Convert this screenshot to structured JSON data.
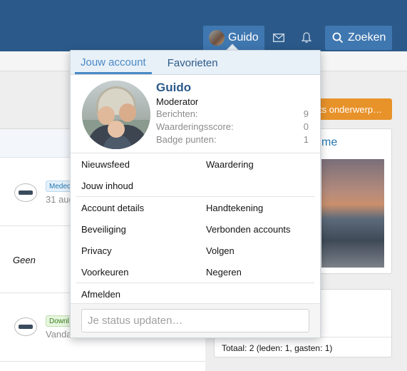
{
  "nav": {
    "username": "Guido",
    "search_label": "Zoeken"
  },
  "page": {
    "badge1": "Medec",
    "row1_date": "31 aug",
    "row2_text": "Geen",
    "badge2": "Downl",
    "row3_text": "Vanda",
    "orange_button": "ts onderwerp…",
    "card_title": "me",
    "totaal": "Totaal: 2 (leden: 1, gasten: 1)"
  },
  "menu": {
    "tabs": [
      "Jouw account",
      "Favorieten"
    ],
    "profile": {
      "name": "Guido",
      "role": "Moderator",
      "stats": [
        {
          "label": "Berichten:",
          "value": "9"
        },
        {
          "label": "Waarderingsscore:",
          "value": "0"
        },
        {
          "label": "Badge punten:",
          "value": "1"
        }
      ]
    },
    "links": {
      "nieuwsfeed": "Nieuwsfeed",
      "waardering": "Waardering",
      "jouw_inhoud": "Jouw inhoud",
      "account_details": "Account details",
      "handtekening": "Handtekening",
      "beveiliging": "Beveiliging",
      "verbonden_accounts": "Verbonden accounts",
      "privacy": "Privacy",
      "volgen": "Volgen",
      "voorkeuren": "Voorkeuren",
      "negeren": "Negeren",
      "afmelden": "Afmelden"
    },
    "status_placeholder": "Je status updaten…"
  },
  "colors": {
    "header": "#2b5a8a",
    "accent": "#4a8ac6",
    "orange": "#e8922a"
  }
}
